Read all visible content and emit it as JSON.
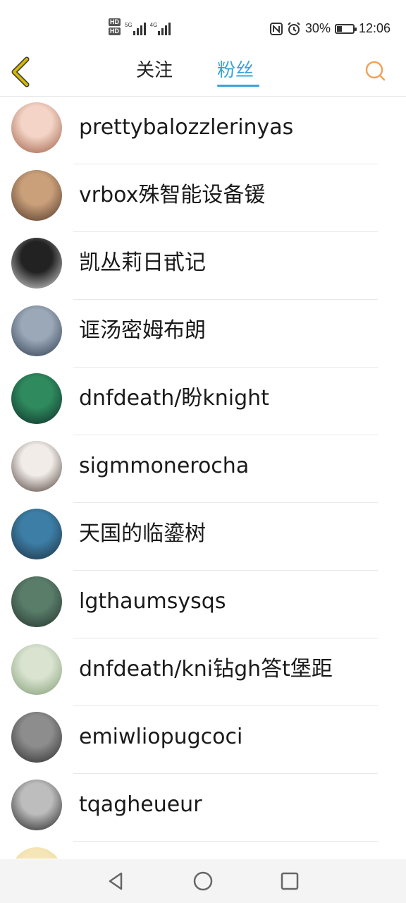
{
  "status_bar": {
    "hd1": "HD",
    "hd2": "HD",
    "net1_label": "5G",
    "net2_label": "4G",
    "battery": "30%",
    "battery_level": 0.3,
    "time": "12:06",
    "icons": [
      "nfc-icon",
      "alarm-icon",
      "battery-icon"
    ]
  },
  "header": {
    "tabs": [
      {
        "label": "关注",
        "active": false
      },
      {
        "label": "粉丝",
        "active": true
      }
    ],
    "accent_color": "#3aa3d8",
    "back_icon_color": "#d4b800",
    "search_icon_color": "#f0a35a"
  },
  "fans": [
    {
      "name": "prettybalozzlerinyas",
      "avatar_colors": [
        "#f3d4c6",
        "#9b5a3f"
      ]
    },
    {
      "name": "vrbox殊智能设备锾",
      "avatar_colors": [
        "#caa07a",
        "#4b3325"
      ]
    },
    {
      "name": "凯丛莉日甙记",
      "avatar_colors": [
        "#222222",
        "#dddddd"
      ]
    },
    {
      "name": "诓汤密姆布朗",
      "avatar_colors": [
        "#9aa8b8",
        "#2e3a4c"
      ]
    },
    {
      "name": "dnfdeath/盼knight",
      "avatar_colors": [
        "#2f8a5e",
        "#0c2a26"
      ]
    },
    {
      "name": "sigmmonerocha",
      "avatar_colors": [
        "#f1ece8",
        "#4a3a35"
      ]
    },
    {
      "name": "天国的临鎏树",
      "avatar_colors": [
        "#3d7ea6",
        "#1d2f3f"
      ]
    },
    {
      "name": "lgthaumsysqs",
      "avatar_colors": [
        "#5a7d6a",
        "#22322a"
      ]
    },
    {
      "name": "dnfdeath/kni钻gh答t堡距",
      "avatar_colors": [
        "#d9e3d0",
        "#7e9a73"
      ]
    },
    {
      "name": "emiwliopugcoci",
      "avatar_colors": [
        "#8d8d8d",
        "#2a2a2a"
      ]
    },
    {
      "name": "tqagheueur",
      "avatar_colors": [
        "#bdbdbd",
        "#1e1e1e"
      ]
    },
    {
      "name": "",
      "avatar_colors": [
        "#f5e6b8",
        "#e8cf8a"
      ]
    }
  ],
  "nav": {
    "icons": [
      "back-triangle-icon",
      "home-circle-icon",
      "recents-square-icon"
    ]
  }
}
